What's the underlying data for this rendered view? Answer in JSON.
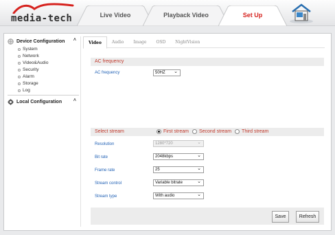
{
  "brand": {
    "name": "media-tech"
  },
  "nav": {
    "tabs": [
      {
        "label": "Live Video",
        "active": false
      },
      {
        "label": "Playback Video",
        "active": false
      },
      {
        "label": "Set Up",
        "active": true
      }
    ],
    "home_icon": "home-icon"
  },
  "sidebar": {
    "device_config": {
      "label": "Device Configuration",
      "icon": "globe-icon"
    },
    "items": [
      "System",
      "Network",
      "Video&Audio",
      "Security",
      "Alarm",
      "Storage",
      "Log"
    ],
    "local_config": {
      "label": "Local Configuration",
      "icon": "gear-icon"
    }
  },
  "subtabs": [
    "Video",
    "Audio",
    "Image",
    "OSD",
    "NightVision"
  ],
  "ac_section": {
    "title": "AC frequency",
    "label": "AC frequency",
    "value": "50HZ"
  },
  "stream_section": {
    "title": "Select stream",
    "options": [
      "First stream",
      "Second stream",
      "Third stream"
    ],
    "selected": "First stream"
  },
  "fields": [
    {
      "label": "Resolution",
      "value": "1280*720",
      "disabled": true
    },
    {
      "label": "Bit rate",
      "value": "2048kbps",
      "disabled": false
    },
    {
      "label": "Frame rate",
      "value": "25",
      "disabled": false
    },
    {
      "label": "Stream control",
      "value": "Variable bitrate",
      "disabled": false
    },
    {
      "label": "Stream type",
      "value": "With audio",
      "disabled": false
    }
  ],
  "buttons": {
    "save": "Save",
    "refresh": "Refresh"
  },
  "colors": {
    "accent_red": "#d6231f",
    "label_blue": "#1e5fb4",
    "section_red": "#c0392b"
  }
}
